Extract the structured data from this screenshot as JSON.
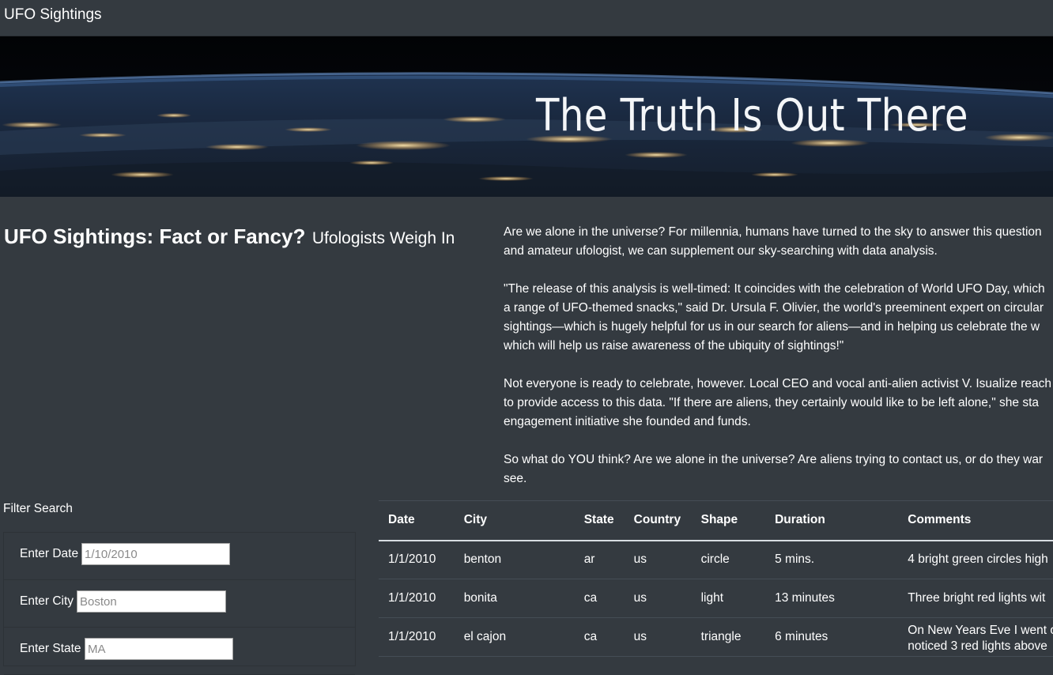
{
  "navbar": {
    "brand": "UFO Sightings"
  },
  "hero": {
    "title": "The Truth Is Out There"
  },
  "article": {
    "heading_main": "UFO Sightings: Fact or Fancy?",
    "heading_sub": "Ufologists Weigh In",
    "paragraphs": [
      [
        "Are we alone in the universe? For millennia, humans have turned to the sky to answer this question",
        "and amateur ufologist, we can supplement our sky-searching with data analysis."
      ],
      [
        "\"The release of this analysis is well-timed: It coincides with the celebration of World UFO Day, which",
        "a range of UFO-themed snacks,\" said Dr. Ursula F. Olivier, the world's preeminent expert on circular",
        "sightings—which is hugely helpful for us in our search for aliens—and in helping us celebrate the w",
        "which will help us raise awareness of the ubiquity of sightings!\""
      ],
      [
        "Not everyone is ready to celebrate, however. Local CEO and vocal anti-alien activist V. Isualize reach",
        "to provide access to this data. \"If there are aliens, they certainly would like to be left alone,\" she sta",
        "engagement initiative she founded and funds."
      ],
      [
        "So what do YOU think? Are we alone in the universe? Are aliens trying to contact us, or do they war",
        "see."
      ]
    ]
  },
  "filters": {
    "title": "Filter Search",
    "fields": [
      {
        "label": "Enter Date",
        "placeholder": "1/10/2010",
        "value": ""
      },
      {
        "label": "Enter City",
        "placeholder": "Boston",
        "value": ""
      },
      {
        "label": "Enter State",
        "placeholder": "MA",
        "value": ""
      }
    ]
  },
  "table": {
    "columns": [
      "Date",
      "City",
      "State",
      "Country",
      "Shape",
      "Duration",
      "Comments"
    ],
    "rows": [
      [
        "1/1/2010",
        "benton",
        "ar",
        "us",
        "circle",
        "5 mins.",
        "4 bright green circles high"
      ],
      [
        "1/1/2010",
        "bonita",
        "ca",
        "us",
        "light",
        "13 minutes",
        "Three bright red lights wit"
      ],
      [
        "1/1/2010",
        "el cajon",
        "ca",
        "us",
        "triangle",
        "6 minutes",
        "On New Years Eve I went o",
        "noticed 3 red lights above"
      ]
    ]
  }
}
